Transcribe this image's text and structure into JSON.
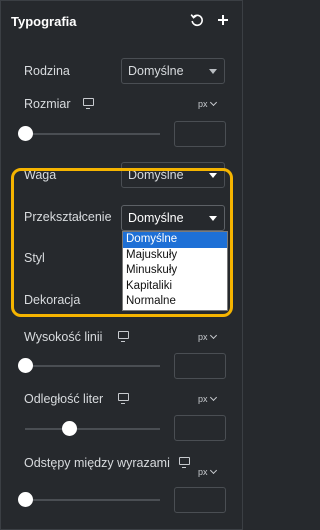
{
  "header": {
    "title": "Typografia",
    "reset_icon": "reset-icon",
    "add_icon": "plus-icon"
  },
  "fields": {
    "family": {
      "label": "Rodzina",
      "value": "Domyślne"
    },
    "size": {
      "label": "Rozmiar",
      "unit": "px",
      "slider": 0.0
    },
    "weight": {
      "label": "Waga",
      "value": "Domyślne"
    },
    "transform": {
      "label": "Przekształcenie",
      "value": "Domyślne",
      "options": [
        "Domyślne",
        "Majuskuły",
        "Minuskuły",
        "Kapitaliki",
        "Normalne"
      ]
    },
    "style": {
      "label": "Styl"
    },
    "decoration": {
      "label": "Dekoracja"
    },
    "line_height": {
      "label": "Wysokość linii",
      "unit": "px",
      "slider": 0.0
    },
    "letter_spacing": {
      "label": "Odległość liter",
      "unit": "px",
      "slider": 0.3
    },
    "word_spacing": {
      "label": "Odstępy między wyrazami",
      "unit": "px",
      "slider": 0.0
    }
  },
  "colors": {
    "highlight": "#f5b400",
    "selected_option": "#1e70d6",
    "panel_bg": "#26292d"
  }
}
